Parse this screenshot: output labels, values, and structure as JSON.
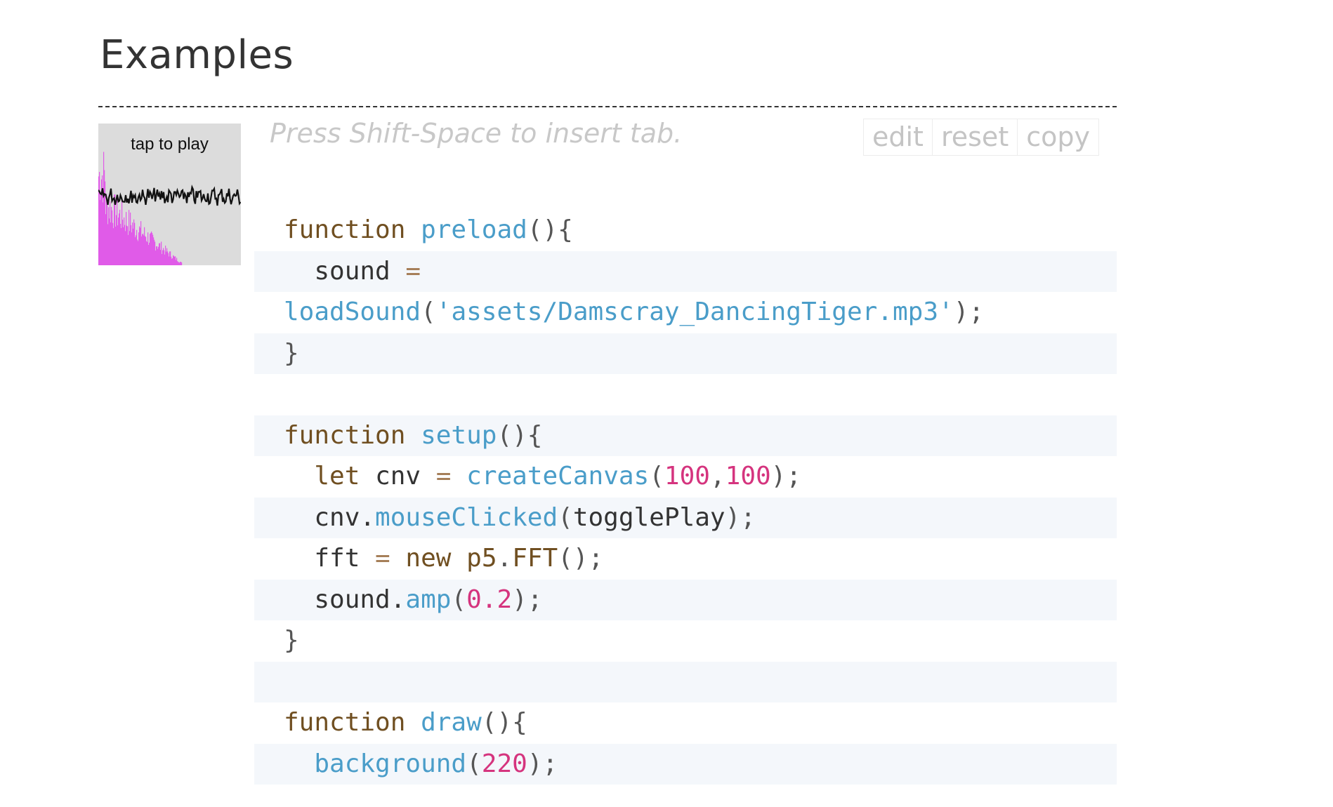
{
  "section": {
    "title": "Examples"
  },
  "preview": {
    "label": "tap to play"
  },
  "editor": {
    "hint": "Press Shift-Space to insert tab.",
    "buttons": [
      "edit",
      "reset",
      "copy"
    ]
  },
  "code_lines": [
    [
      [
        "kw",
        "function"
      ],
      [
        "pl",
        " "
      ],
      [
        "fn",
        "preload"
      ],
      [
        "pn",
        "(){"
      ]
    ],
    [
      [
        "pl",
        "  sound "
      ],
      [
        "op",
        "="
      ]
    ],
    [
      [
        "fn",
        "loadSound"
      ],
      [
        "pn",
        "("
      ],
      [
        "str",
        "'assets/Damscray_DancingTiger.mp3'"
      ],
      [
        "pn",
        ");"
      ]
    ],
    [
      [
        "pn",
        "}"
      ]
    ],
    [],
    [
      [
        "kw",
        "function"
      ],
      [
        "pl",
        " "
      ],
      [
        "fn",
        "setup"
      ],
      [
        "pn",
        "(){"
      ]
    ],
    [
      [
        "pl",
        "  "
      ],
      [
        "kw",
        "let"
      ],
      [
        "pl",
        " cnv "
      ],
      [
        "op",
        "="
      ],
      [
        "pl",
        " "
      ],
      [
        "fn",
        "createCanvas"
      ],
      [
        "pn",
        "("
      ],
      [
        "num",
        "100"
      ],
      [
        "pn",
        ","
      ],
      [
        "num",
        "100"
      ],
      [
        "pn",
        ");"
      ]
    ],
    [
      [
        "pl",
        "  cnv."
      ],
      [
        "fn",
        "mouseClicked"
      ],
      [
        "pn",
        "("
      ],
      [
        "pl",
        "togglePlay"
      ],
      [
        "pn",
        ");"
      ]
    ],
    [
      [
        "pl",
        "  fft "
      ],
      [
        "op",
        "="
      ],
      [
        "pl",
        " "
      ],
      [
        "kw",
        "new"
      ],
      [
        "pl",
        " "
      ],
      [
        "kw",
        "p5"
      ],
      [
        "pn",
        "."
      ],
      [
        "kw",
        "FFT"
      ],
      [
        "pn",
        "();"
      ]
    ],
    [
      [
        "pl",
        "  sound."
      ],
      [
        "fn",
        "amp"
      ],
      [
        "pn",
        "("
      ],
      [
        "num",
        "0.2"
      ],
      [
        "pn",
        ");"
      ]
    ],
    [
      [
        "pn",
        "}"
      ]
    ],
    [],
    [
      [
        "kw",
        "function"
      ],
      [
        "pl",
        " "
      ],
      [
        "fn",
        "draw"
      ],
      [
        "pn",
        "(){"
      ]
    ],
    [
      [
        "pl",
        "  "
      ],
      [
        "fn",
        "background"
      ],
      [
        "pn",
        "("
      ],
      [
        "num",
        "220"
      ],
      [
        "pn",
        ");"
      ]
    ]
  ]
}
